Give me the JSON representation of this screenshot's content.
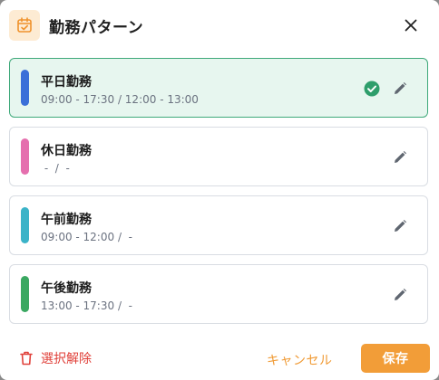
{
  "dialog": {
    "title": "勤務パターン",
    "header_icon": "calendar-check-icon",
    "close_icon": "close-icon"
  },
  "patterns": [
    {
      "name": "平日勤務",
      "time": "09:00 - 17:30 / 12:00 - 13:00",
      "color": "#3b6fd8",
      "selected": true
    },
    {
      "name": "休日勤務",
      "time": " -  /  -",
      "color": "#e56fae",
      "selected": false
    },
    {
      "name": "午前勤務",
      "time": "09:00 - 12:00 /  -",
      "color": "#3bb3c8",
      "selected": false
    },
    {
      "name": "午後勤務",
      "time": "13:00 - 17:30 /  -",
      "color": "#3aa861",
      "selected": false
    }
  ],
  "footer": {
    "deselect_label": "選択解除",
    "cancel_label": "キャンセル",
    "save_label": "保存"
  },
  "colors": {
    "accent": "#f29d38",
    "danger": "#e0413a",
    "selected_bg": "#e7f6ef",
    "selected_border": "#3ea97a",
    "check": "#2e9e6b"
  }
}
